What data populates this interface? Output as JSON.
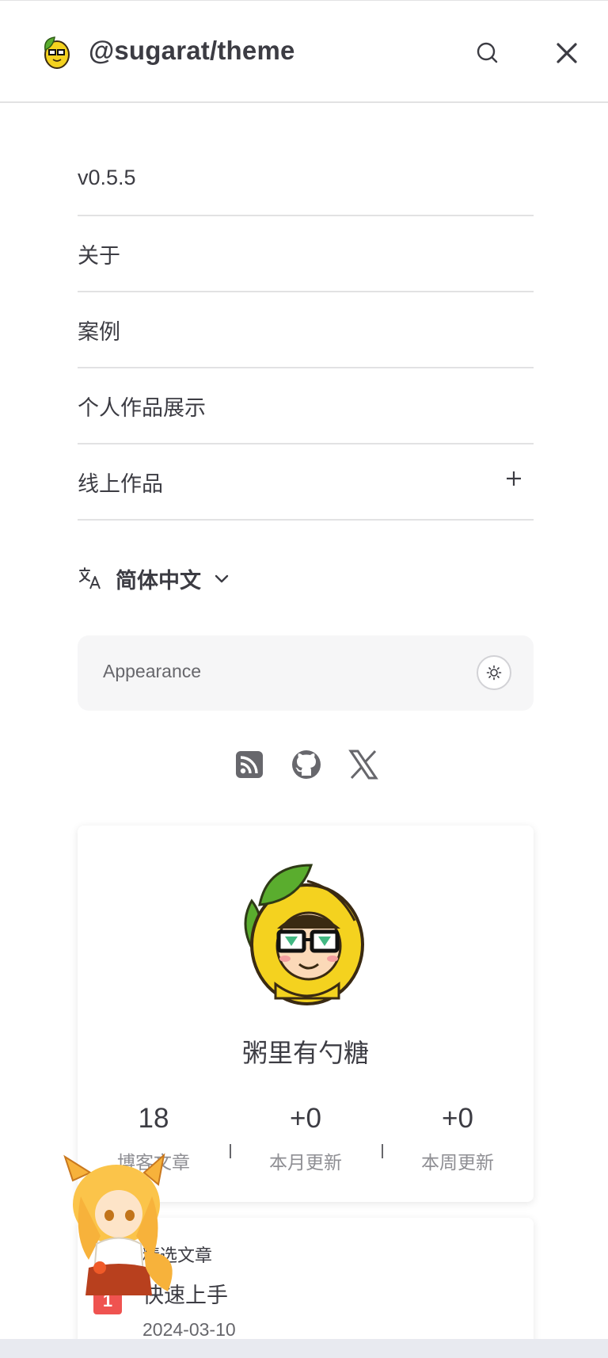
{
  "header": {
    "title": "@sugarat/theme"
  },
  "menu": {
    "items": [
      {
        "label": "v0.5.5"
      },
      {
        "label": "关于"
      },
      {
        "label": "案例"
      },
      {
        "label": "个人作品展示"
      },
      {
        "label": "线上作品"
      }
    ]
  },
  "language": {
    "label": "简体中文"
  },
  "appearance": {
    "label": "Appearance"
  },
  "profile": {
    "name": "粥里有勺糖",
    "stats": [
      {
        "value": "18",
        "label": "博客文章"
      },
      {
        "value": "+0",
        "label": "本月更新"
      },
      {
        "value": "+0",
        "label": "本周更新"
      }
    ]
  },
  "featured": {
    "heading": "精选文章",
    "badge": "1",
    "post_title": "快速上手",
    "post_date": "2024-03-10"
  },
  "colors": {
    "text": "#3c3c43",
    "muted": "#8e8e93",
    "divider": "#e2e2e3",
    "panel": "#f6f6f7",
    "badge": "#ef5350"
  },
  "icons": [
    "logo",
    "search-icon",
    "close-icon",
    "plus-icon",
    "translate-icon",
    "chevron-down-icon",
    "sun-icon",
    "rss-icon",
    "github-icon",
    "x-icon"
  ]
}
